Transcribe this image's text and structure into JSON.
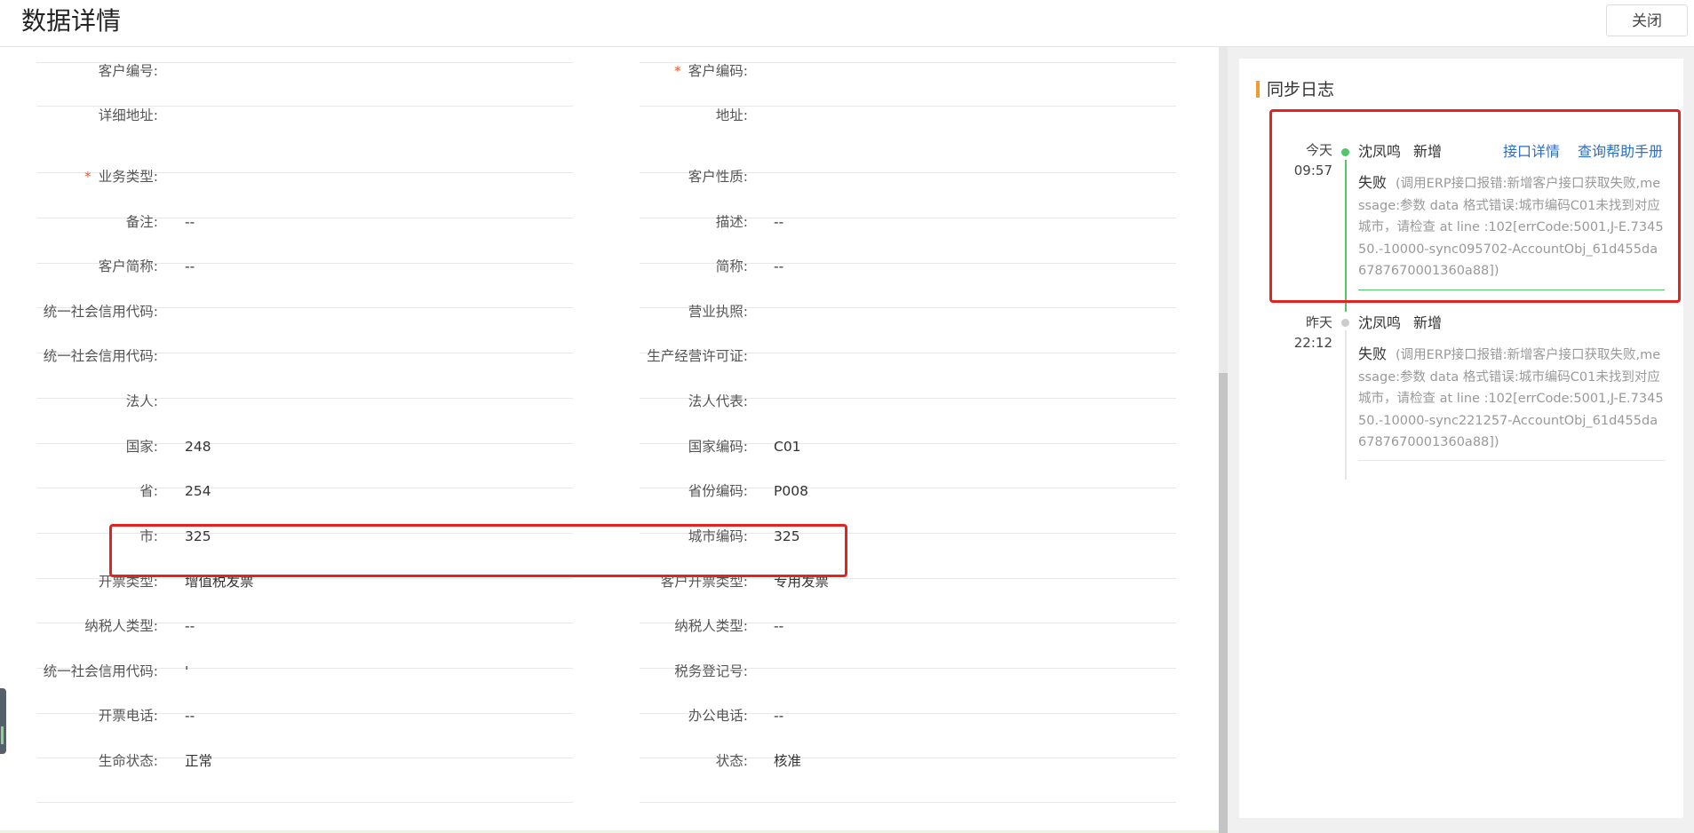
{
  "header": {
    "title": "数据详情",
    "close_label": "关闭"
  },
  "form": {
    "rows": [
      {
        "left": {
          "label": "客户编号:",
          "value": ""
        },
        "right": {
          "label": "客户编码:",
          "value": "",
          "required": true
        }
      },
      {
        "left": {
          "label": "详细地址:",
          "value": ""
        },
        "right": {
          "label": "地址:",
          "value": ""
        }
      },
      {
        "left": {
          "label": "业务类型:",
          "value": "",
          "required": true
        },
        "right": {
          "label": "客户性质:",
          "value": ""
        }
      },
      {
        "left": {
          "label": "备注:",
          "value": "--"
        },
        "right": {
          "label": "描述:",
          "value": "--"
        }
      },
      {
        "left": {
          "label": "客户简称:",
          "value": "--"
        },
        "right": {
          "label": "简称:",
          "value": "--"
        }
      },
      {
        "left": {
          "label": "统一社会信用代码:",
          "value": ""
        },
        "right": {
          "label": "营业执照:",
          "value": ""
        }
      },
      {
        "left": {
          "label": "统一社会信用代码:",
          "value": ""
        },
        "right": {
          "label": "生产经营许可证:",
          "value": ""
        }
      },
      {
        "left": {
          "label": "法人:",
          "value": ""
        },
        "right": {
          "label": "法人代表:",
          "value": ""
        }
      },
      {
        "left": {
          "label": "国家:",
          "value": "248"
        },
        "right": {
          "label": "国家编码:",
          "value": "C01"
        }
      },
      {
        "left": {
          "label": "省:",
          "value": "254"
        },
        "right": {
          "label": "省份编码:",
          "value": "P008"
        }
      },
      {
        "left": {
          "label": "市:",
          "value": "325"
        },
        "right": {
          "label": "城市编码:",
          "value": "325"
        }
      },
      {
        "left": {
          "label": "开票类型:",
          "value": "增值税发票"
        },
        "right": {
          "label": "客户开票类型:",
          "value": "专用发票"
        }
      },
      {
        "left": {
          "label": "纳税人类型:",
          "value": "--"
        },
        "right": {
          "label": "纳税人类型:",
          "value": "--"
        }
      },
      {
        "left": {
          "label": "统一社会信用代码:",
          "value": "'"
        },
        "right": {
          "label": "税务登记号:",
          "value": ""
        }
      },
      {
        "left": {
          "label": "开票电话:",
          "value": "--"
        },
        "right": {
          "label": "办公电话:",
          "value": "--"
        }
      },
      {
        "left": {
          "label": "生命状态:",
          "value": "正常"
        },
        "right": {
          "label": "状态:",
          "value": "核准"
        }
      }
    ]
  },
  "sync_log": {
    "title": "同步日志",
    "entries": [
      {
        "day": "今天",
        "time": "09:57",
        "user": "沈凤鸣",
        "action": "新增",
        "status": "失败",
        "message": "(调用ERP接口报错:新增客户接口获取失败,message:参数 data 格式错误:城市编码C01未找到对应城市，请检查 at line :102[errCode:5001,J-E.734550.-10000-sync095702-AccountObj_61d455da6787670001360a88])",
        "links": [
          "接口详情",
          "查询帮助手册"
        ],
        "dot_color": "#52c56c"
      },
      {
        "day": "昨天",
        "time": "22:12",
        "user": "沈凤鸣",
        "action": "新增",
        "status": "失败",
        "message": "(调用ERP接口报错:新增客户接口获取失败,message:参数 data 格式错误:城市编码C01未找到对应城市，请检查 at line :102[errCode:5001,J-E.734550.-10000-sync221257-AccountObj_61d455da6787670001360a88])",
        "links": [],
        "dot_color": "#cccccc"
      }
    ]
  },
  "colors": {
    "accent_orange": "#f39b2f",
    "link_blue": "#2b6ec4",
    "annotation_red": "#e32222",
    "success_green": "#52c56c"
  }
}
